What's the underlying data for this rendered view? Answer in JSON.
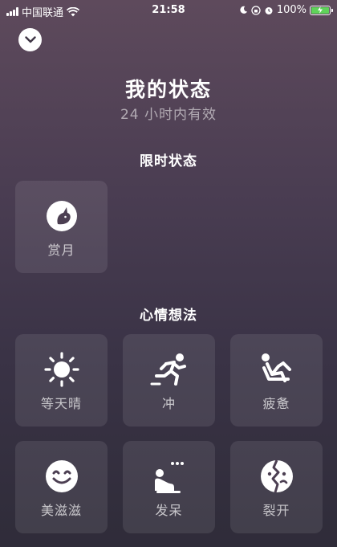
{
  "status_bar": {
    "carrier": "中国联通",
    "time": "21:58",
    "battery_percent": "100%",
    "battery_color": "#5fd35a"
  },
  "header": {
    "collapse_icon": "chevron-down-icon",
    "title": "我的状态",
    "subtitle": "24 小时内有效"
  },
  "sections": {
    "limited": {
      "title": "限时状态",
      "items": [
        {
          "label": "赏月",
          "icon": "rabbit-moon-icon"
        }
      ]
    },
    "mood": {
      "title": "心情想法",
      "items": [
        {
          "label": "等天晴",
          "icon": "sun-icon"
        },
        {
          "label": "冲",
          "icon": "running-icon"
        },
        {
          "label": "疲惫",
          "icon": "reclining-icon"
        },
        {
          "label": "美滋滋",
          "icon": "smile-icon"
        },
        {
          "label": "发呆",
          "icon": "daze-icon"
        },
        {
          "label": "裂开",
          "icon": "cracked-face-icon"
        }
      ]
    }
  }
}
